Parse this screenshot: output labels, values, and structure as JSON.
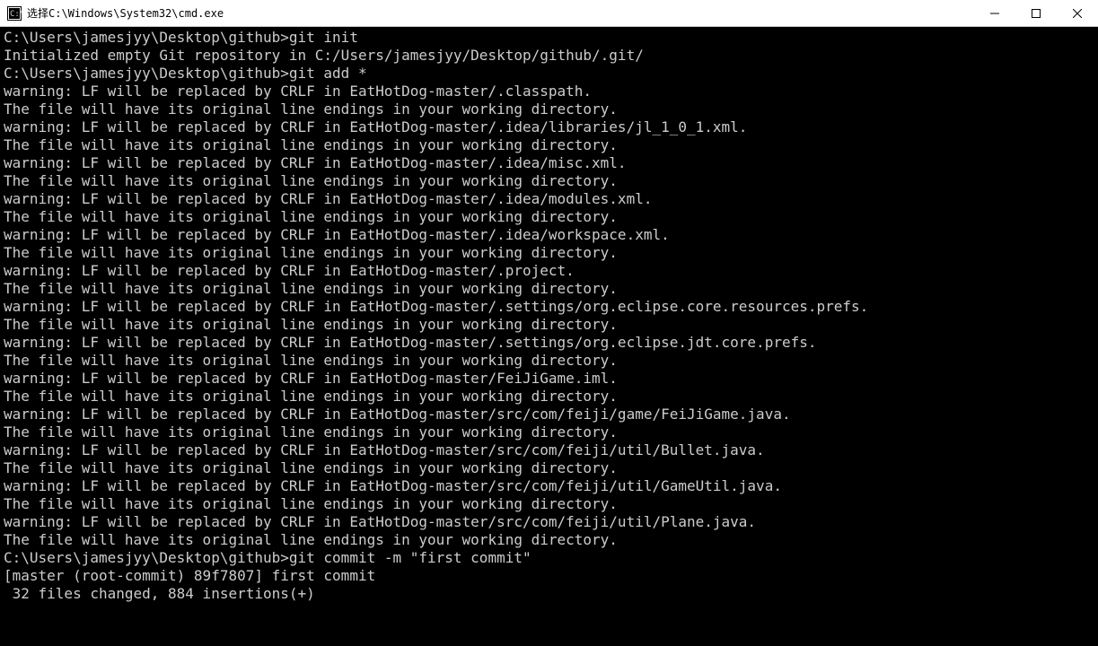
{
  "window": {
    "title": "选择C:\\Windows\\System32\\cmd.exe"
  },
  "prompt": "C:\\Users\\jamesjyy\\Desktop\\github>",
  "lines": [
    "C:\\Users\\jamesjyy\\Desktop\\github>git init",
    "Initialized empty Git repository in C:/Users/jamesjyy/Desktop/github/.git/",
    "",
    "C:\\Users\\jamesjyy\\Desktop\\github>git add *",
    "warning: LF will be replaced by CRLF in EatHotDog-master/.classpath.",
    "The file will have its original line endings in your working directory.",
    "warning: LF will be replaced by CRLF in EatHotDog-master/.idea/libraries/jl_1_0_1.xml.",
    "The file will have its original line endings in your working directory.",
    "warning: LF will be replaced by CRLF in EatHotDog-master/.idea/misc.xml.",
    "The file will have its original line endings in your working directory.",
    "warning: LF will be replaced by CRLF in EatHotDog-master/.idea/modules.xml.",
    "The file will have its original line endings in your working directory.",
    "warning: LF will be replaced by CRLF in EatHotDog-master/.idea/workspace.xml.",
    "The file will have its original line endings in your working directory.",
    "warning: LF will be replaced by CRLF in EatHotDog-master/.project.",
    "The file will have its original line endings in your working directory.",
    "warning: LF will be replaced by CRLF in EatHotDog-master/.settings/org.eclipse.core.resources.prefs.",
    "The file will have its original line endings in your working directory.",
    "warning: LF will be replaced by CRLF in EatHotDog-master/.settings/org.eclipse.jdt.core.prefs.",
    "The file will have its original line endings in your working directory.",
    "warning: LF will be replaced by CRLF in EatHotDog-master/FeiJiGame.iml.",
    "The file will have its original line endings in your working directory.",
    "warning: LF will be replaced by CRLF in EatHotDog-master/src/com/feiji/game/FeiJiGame.java.",
    "The file will have its original line endings in your working directory.",
    "warning: LF will be replaced by CRLF in EatHotDog-master/src/com/feiji/util/Bullet.java.",
    "The file will have its original line endings in your working directory.",
    "warning: LF will be replaced by CRLF in EatHotDog-master/src/com/feiji/util/GameUtil.java.",
    "The file will have its original line endings in your working directory.",
    "warning: LF will be replaced by CRLF in EatHotDog-master/src/com/feiji/util/Plane.java.",
    "The file will have its original line endings in your working directory.",
    "",
    "C:\\Users\\jamesjyy\\Desktop\\github>git commit -m \"first commit\"",
    "[master (root-commit) 89f7807] first commit",
    " 32 files changed, 884 insertions(+)"
  ]
}
